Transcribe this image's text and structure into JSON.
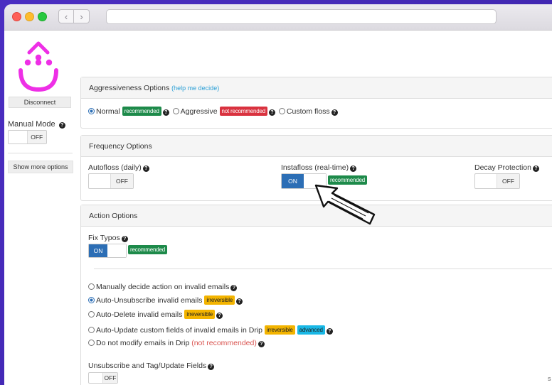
{
  "sidebar": {
    "disconnect_label": "Disconnect",
    "manual_mode_label": "Manual Mode",
    "manual_mode_state": "OFF",
    "show_more_label": "Show more options"
  },
  "aggressiveness": {
    "title": "Aggressiveness Options",
    "help_link": "(help me decide)",
    "options": [
      {
        "label": "Normal",
        "badge": "recommended",
        "checked": true
      },
      {
        "label": "Aggressive",
        "badge": "not recommended",
        "checked": false
      },
      {
        "label": "Custom floss",
        "checked": false
      }
    ]
  },
  "frequency": {
    "title": "Frequency Options",
    "autofloss": {
      "label": "Autofloss (daily)",
      "state": "OFF"
    },
    "instafloss": {
      "label": "Instafloss (real-time)",
      "state": "ON",
      "badge": "recommended"
    },
    "decay": {
      "label": "Decay Protection",
      "state": "OFF"
    }
  },
  "action": {
    "title": "Action Options",
    "fix_typos": {
      "label": "Fix Typos",
      "state": "ON",
      "badge": "recommended"
    },
    "invalid_options": [
      {
        "label": "Manually decide action on invalid emails",
        "checked": false
      },
      {
        "label": "Auto-Unsubscribe invalid emails",
        "badge": "irreversible",
        "checked": true
      },
      {
        "label": "Auto-Delete invalid emails",
        "badge": "irreversible",
        "checked": false
      },
      {
        "label": "Auto-Update custom fields of invalid emails in Drip",
        "badge": "irreversible",
        "badge2": "advanced",
        "checked": false
      },
      {
        "label": "Do not modify emails in Drip",
        "note": "(not recommended)",
        "checked": false
      }
    ],
    "unsubscribe_tag": {
      "label": "Unsubscribe and Tag/Update Fields",
      "state": "OFF"
    },
    "edge_text": "s"
  },
  "colors": {
    "brand": "#ee2fe6",
    "toggle_on": "#2c6eb5",
    "recommended": "#1d8a4a",
    "not_recommended": "#d9323f",
    "irreversible": "#f3b400",
    "advanced": "#19b8e6"
  }
}
